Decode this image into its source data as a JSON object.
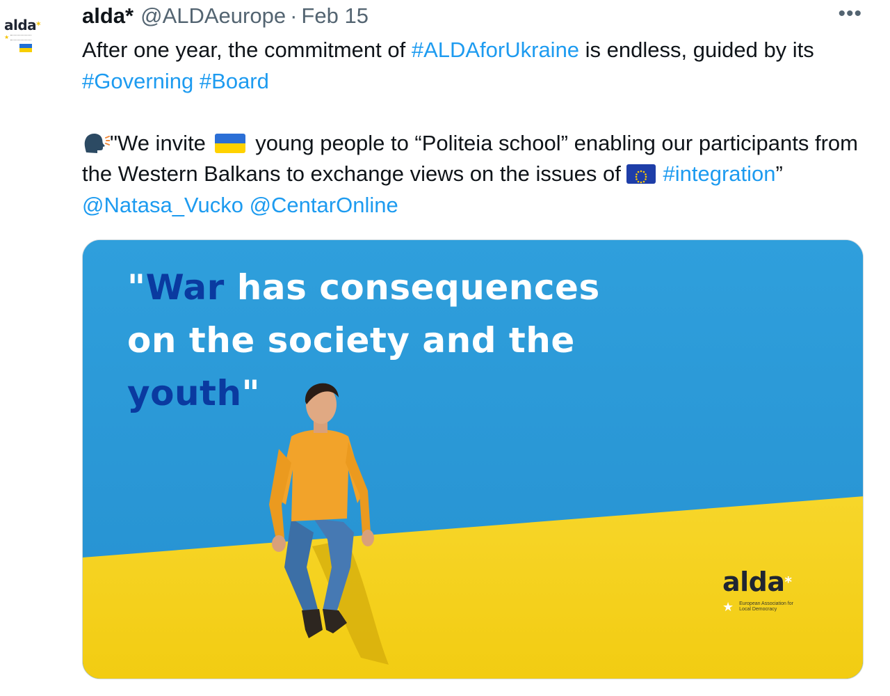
{
  "tweet": {
    "author_name": "alda*",
    "author_handle": "@ALDAeurope",
    "separator": "·",
    "date": "Feb 15",
    "more_label": "•••",
    "avatar": {
      "logo_text": "alda",
      "logo_star": "*",
      "tagline": "European Association for Local Democracy"
    },
    "paragraph1": {
      "t1": "After one year, the commitment of ",
      "l1": "#ALDAforUkraine",
      "t2": " is endless, guided by its ",
      "l2": "#Governing",
      "t3": " ",
      "l3": "#Board"
    },
    "paragraph2": {
      "t1": "\"We invite",
      "t2": "young people to “Politeia school” enabling our participants from the Western Balkans to exchange views on the issues of ",
      "l1": "#integration",
      "t3": "” ",
      "l2": "@Natasa_Vucko",
      "t4": " ",
      "l3": "@CentarOnline"
    },
    "media": {
      "quote_q1": "\"",
      "quote_war": "War",
      "quote_mid": " has consequences on the society and the ",
      "quote_youth": "youth",
      "quote_q2": "\"",
      "brand_logo": "alda",
      "brand_star": "*",
      "brand_tagline": "European Association for Local Democracy"
    }
  },
  "colors": {
    "link": "#1d9bf0",
    "text": "#0f1419",
    "secondary": "#536471",
    "sky_blue": "#2a98d8",
    "wall_yellow": "#f6d21c",
    "quote_dark": "#0a3aa0"
  },
  "icons": [
    "more-icon",
    "speaking-head-icon",
    "ukraine-flag-icon",
    "eu-flag-icon",
    "alda-star-icon"
  ]
}
